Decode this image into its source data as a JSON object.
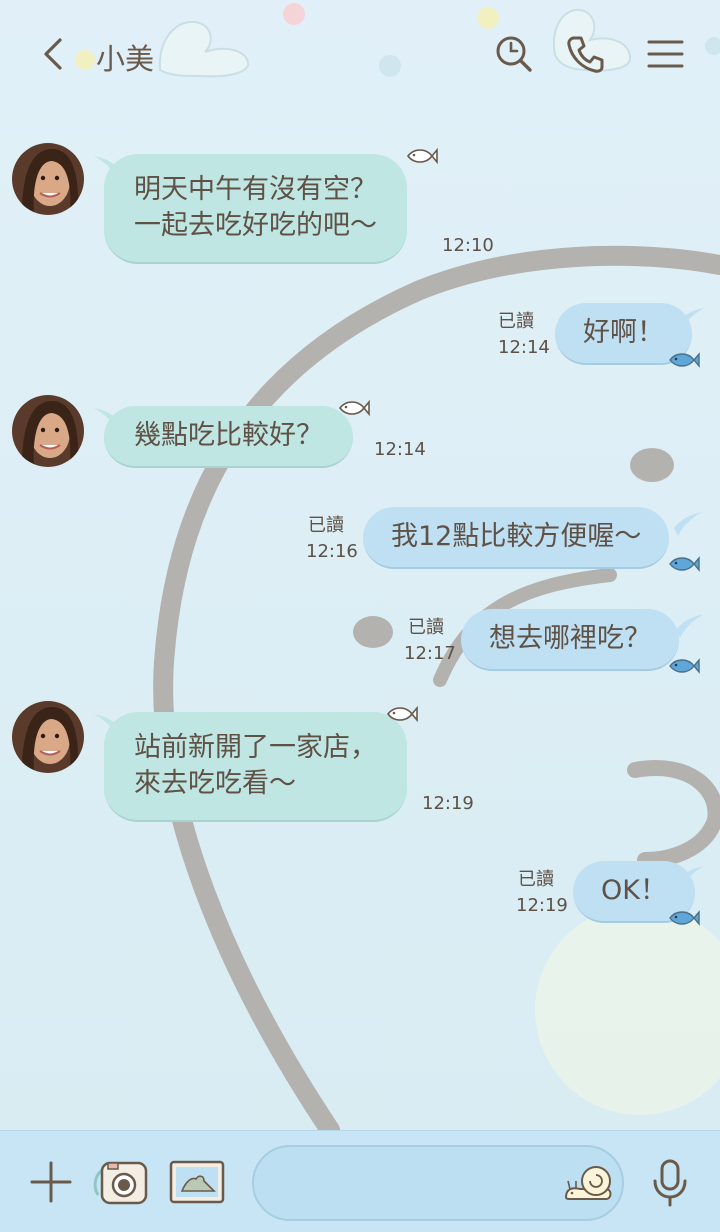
{
  "header": {
    "title": "小美",
    "back_icon": "chevron-left-icon",
    "search_icon": "search-icon",
    "call_icon": "phone-icon",
    "menu_icon": "menu-icon"
  },
  "messages": [
    {
      "side": "in",
      "text": "明天中午有沒有空？\n一起去吃好吃的吧～",
      "time": "12:10"
    },
    {
      "side": "out",
      "text": "好啊！",
      "read": "已讀",
      "time": "12:14"
    },
    {
      "side": "in",
      "text": "幾點吃比較好？",
      "time": "12:14"
    },
    {
      "side": "out",
      "text": "我12點比較方便喔～",
      "read": "已讀",
      "time": "12:16"
    },
    {
      "side": "out",
      "text": "想去哪裡吃？",
      "read": "已讀",
      "time": "12:17"
    },
    {
      "side": "in",
      "text": "站前新開了一家店，\n來去吃吃看～",
      "time": "12:19"
    },
    {
      "side": "out",
      "text": "OK！",
      "read": "已讀",
      "time": "12:19"
    }
  ],
  "composer": {
    "input_value": "",
    "icons": [
      "plus-icon",
      "camera-icon",
      "image-icon",
      "snail-sticker-icon",
      "microphone-icon"
    ]
  },
  "colors": {
    "background": "#dcedf4",
    "incoming_bubble": "#bfe6e3",
    "outgoing_bubble": "#bfe0f3",
    "text": "#6a5a4c",
    "composer": "#c7e5f4"
  }
}
